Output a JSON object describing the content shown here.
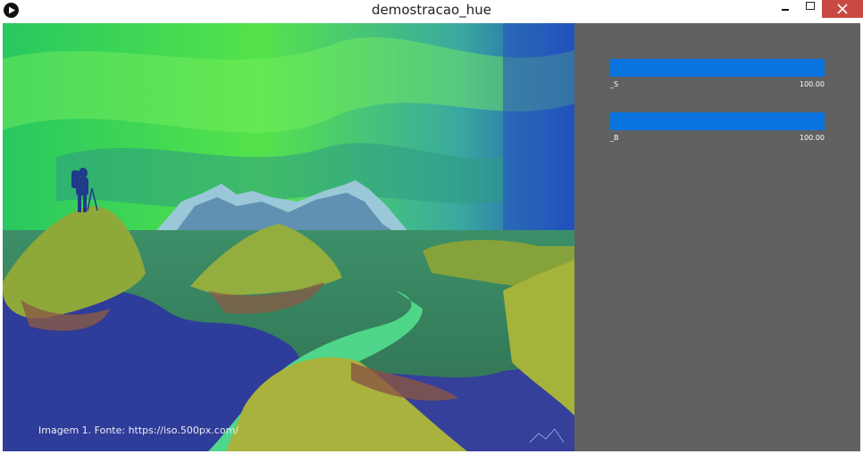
{
  "window": {
    "title": "demostracao_hue",
    "icons": {
      "app": "play-icon",
      "minimize": "minimize-icon",
      "maximize": "maximize-icon",
      "close": "close-icon"
    },
    "colors": {
      "close_button": "#c94a42",
      "panel_background": "#616161",
      "slider_color": "#0069d3"
    }
  },
  "image": {
    "caption": "Imagem 1. Fonte: https://iso.500px.com/"
  },
  "sliders": [
    {
      "name": "_S",
      "value": "100.00",
      "level": 1.0
    },
    {
      "name": "_B",
      "value": "100.00",
      "level": 1.0
    }
  ]
}
